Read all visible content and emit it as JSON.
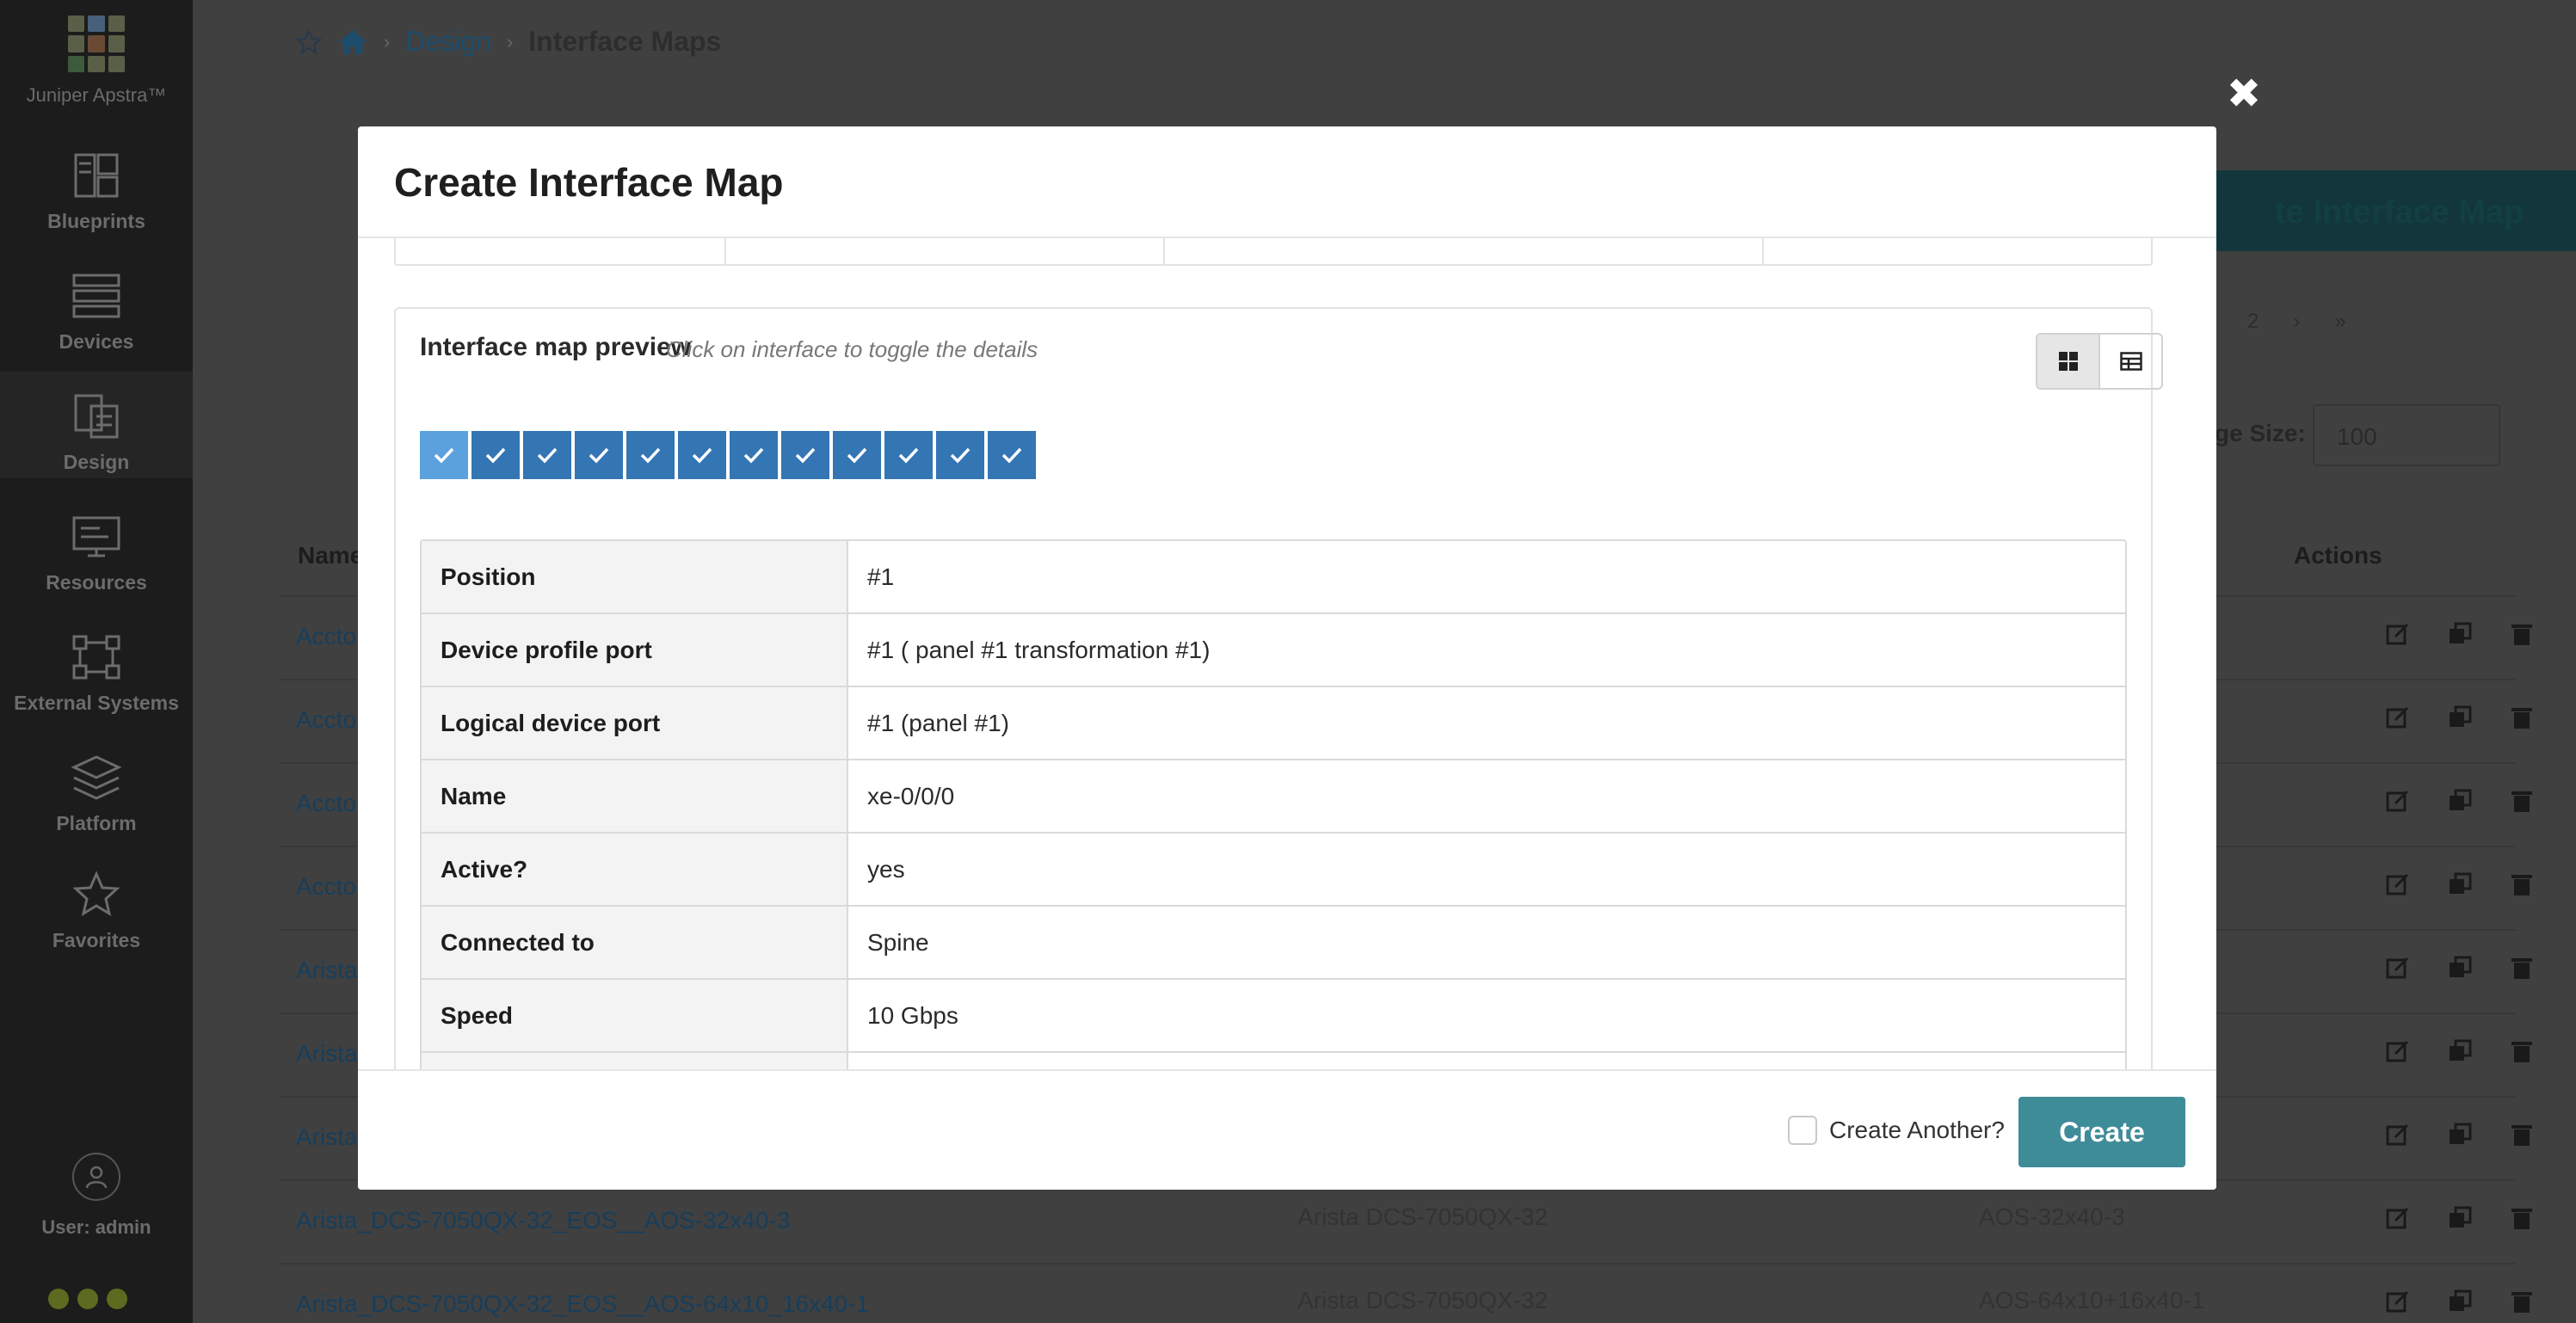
{
  "brand": {
    "name": "Juniper Apstra™"
  },
  "sidebar": {
    "items": [
      {
        "label": "Blueprints",
        "icon": "blueprints-icon"
      },
      {
        "label": "Devices",
        "icon": "devices-icon"
      },
      {
        "label": "Design",
        "icon": "design-icon"
      },
      {
        "label": "Resources",
        "icon": "resources-icon"
      },
      {
        "label": "External Systems",
        "icon": "external-systems-icon"
      },
      {
        "label": "Platform",
        "icon": "platform-icon"
      },
      {
        "label": "Favorites",
        "icon": "star-icon"
      }
    ],
    "user": "User: admin"
  },
  "breadcrumb": {
    "section": "Design",
    "current": "Interface Maps"
  },
  "page": {
    "create_button": "te Interface Map",
    "pager_page": "2",
    "page_size_label": "ge Size:",
    "page_size_value": "100",
    "columns": {
      "name": "Name",
      "actions": "Actions"
    },
    "rows": [
      {
        "name": "Accto",
        "device_profile": "",
        "logical_device": ""
      },
      {
        "name": "Accto",
        "device_profile": "",
        "logical_device": ""
      },
      {
        "name": "Accto",
        "device_profile": "",
        "logical_device": ""
      },
      {
        "name": "Accto",
        "device_profile": "",
        "logical_device": ""
      },
      {
        "name": "Arista",
        "device_profile": "",
        "logical_device": ""
      },
      {
        "name": "Arista",
        "device_profile": "",
        "logical_device": ""
      },
      {
        "name": "Arista",
        "device_profile": "",
        "logical_device": ""
      },
      {
        "name": "Arista_DCS-7050QX-32_EOS__AOS-32x40-3",
        "device_profile": "Arista DCS-7050QX-32",
        "logical_device": "AOS-32x40-3"
      },
      {
        "name": "Arista_DCS-7050QX-32_EOS__AOS-64x10_16x40-1",
        "device_profile": "Arista DCS-7050QX-32",
        "logical_device": "AOS-64x10+16x40-1"
      }
    ]
  },
  "modal": {
    "title": "Create Interface Map",
    "preview": {
      "title": "Interface map preview",
      "hint": "Click on interface to toggle the details",
      "port_count": 12,
      "selected_port_index": 0
    },
    "details": [
      {
        "key": "Position",
        "value": "#1"
      },
      {
        "key": "Device profile port",
        "value": "#1 ( panel #1 transformation #1)"
      },
      {
        "key": "Logical device port",
        "value": "#1 (panel #1)"
      },
      {
        "key": "Name",
        "value": "xe-0/0/0"
      },
      {
        "key": "Active?",
        "value": "yes"
      },
      {
        "key": "Connected to",
        "value": "Spine"
      },
      {
        "key": "Speed",
        "value": "10 Gbps"
      }
    ],
    "footer": {
      "create_another_label": "Create Another?",
      "create_another_checked": false,
      "create_button": "Create"
    }
  },
  "colors": {
    "port": "#3475b4",
    "port_selected": "#5ba1dd",
    "create_button": "#3f8c99"
  }
}
